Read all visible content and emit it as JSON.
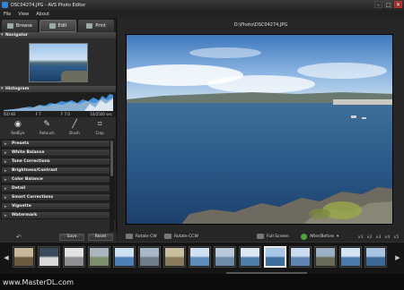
{
  "window": {
    "title": "DSC04274.JPG - AVS Photo Editor",
    "controls": [
      "–",
      "□",
      "✕"
    ]
  },
  "menu": [
    "File",
    "View",
    "About"
  ],
  "mode_tabs": [
    {
      "label": "Browse",
      "icon": "folder-icon"
    },
    {
      "label": "Edit",
      "icon": "edit-icon"
    },
    {
      "label": "Print",
      "icon": "printer-icon"
    }
  ],
  "active_mode": "Edit",
  "navigator": {
    "title": "Navigator"
  },
  "histogram": {
    "title": "Histogram",
    "iso": "ISO 80",
    "focal": "F 7",
    "aperture": "F 7.0",
    "shutter": "10/2500 sec"
  },
  "tools": [
    {
      "label": "RedEye",
      "icon": "eye-icon"
    },
    {
      "label": "Retouch",
      "icon": "retouch-icon"
    },
    {
      "label": "Brush",
      "icon": "brush-icon"
    },
    {
      "label": "Crop",
      "icon": "crop-icon"
    }
  ],
  "effects": [
    "Presets",
    "White Balance",
    "Tone Corrections",
    "Brightness/Contrast",
    "Color Balance",
    "Detail",
    "Smart Corrections",
    "Vignette",
    "Watermark"
  ],
  "bottom_buttons": {
    "save": "Save",
    "reset": "Reset"
  },
  "main": {
    "path": "D:\\Photo\\DSC04274.JPG"
  },
  "view_tools": {
    "rotate_cw": "Rotate CW",
    "rotate_ccw": "Rotate CCW",
    "full_screen": "Full Screen",
    "after_before": "After/Before",
    "zoom_levels": [
      "×1",
      "×2",
      "×3",
      "×4",
      "×5"
    ]
  },
  "filmstrip_count": 15,
  "filmstrip_selected": 10,
  "watermark_text": "www.MasterDL.com"
}
